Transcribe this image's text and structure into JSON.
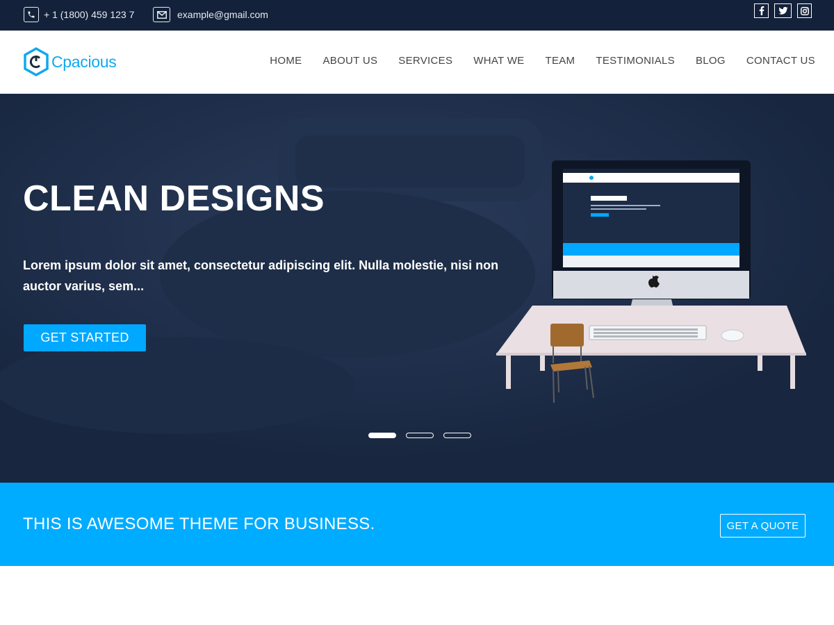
{
  "topbar": {
    "phone": "+ 1 (1800) 459 123 7",
    "email": "example@gmail.com",
    "phone_icon": "phone-icon",
    "email_icon": "envelope-icon",
    "socials": [
      {
        "icon": "facebook-icon",
        "glyph": "f"
      },
      {
        "icon": "twitter-icon",
        "glyph": "t"
      },
      {
        "icon": "instagram-icon",
        "glyph": "ig"
      }
    ]
  },
  "header": {
    "logo_text": "Cpacious",
    "nav": [
      "HOME",
      "ABOUT US",
      "SERVICES",
      "WHAT WE",
      "TEAM",
      "TESTIMONIALS",
      "BLOG",
      "CONTACT US"
    ]
  },
  "hero": {
    "title": "CLEAN DESIGNS",
    "text": "Lorem ipsum dolor sit amet, consectetur adipiscing elit. Nulla molestie, nisi non auctor varius, sem...",
    "cta_label": "GET STARTED",
    "slides": 3,
    "active_slide": 1
  },
  "banner": {
    "text": "THIS IS AWESOME THEME FOR BUSINESS.",
    "button_label": "GET A QUOTE"
  },
  "colors": {
    "topbar_bg": "#14213a",
    "accent": "#00acff",
    "hero_bg": "#1b2b46",
    "logo": "#0fa8f0"
  }
}
